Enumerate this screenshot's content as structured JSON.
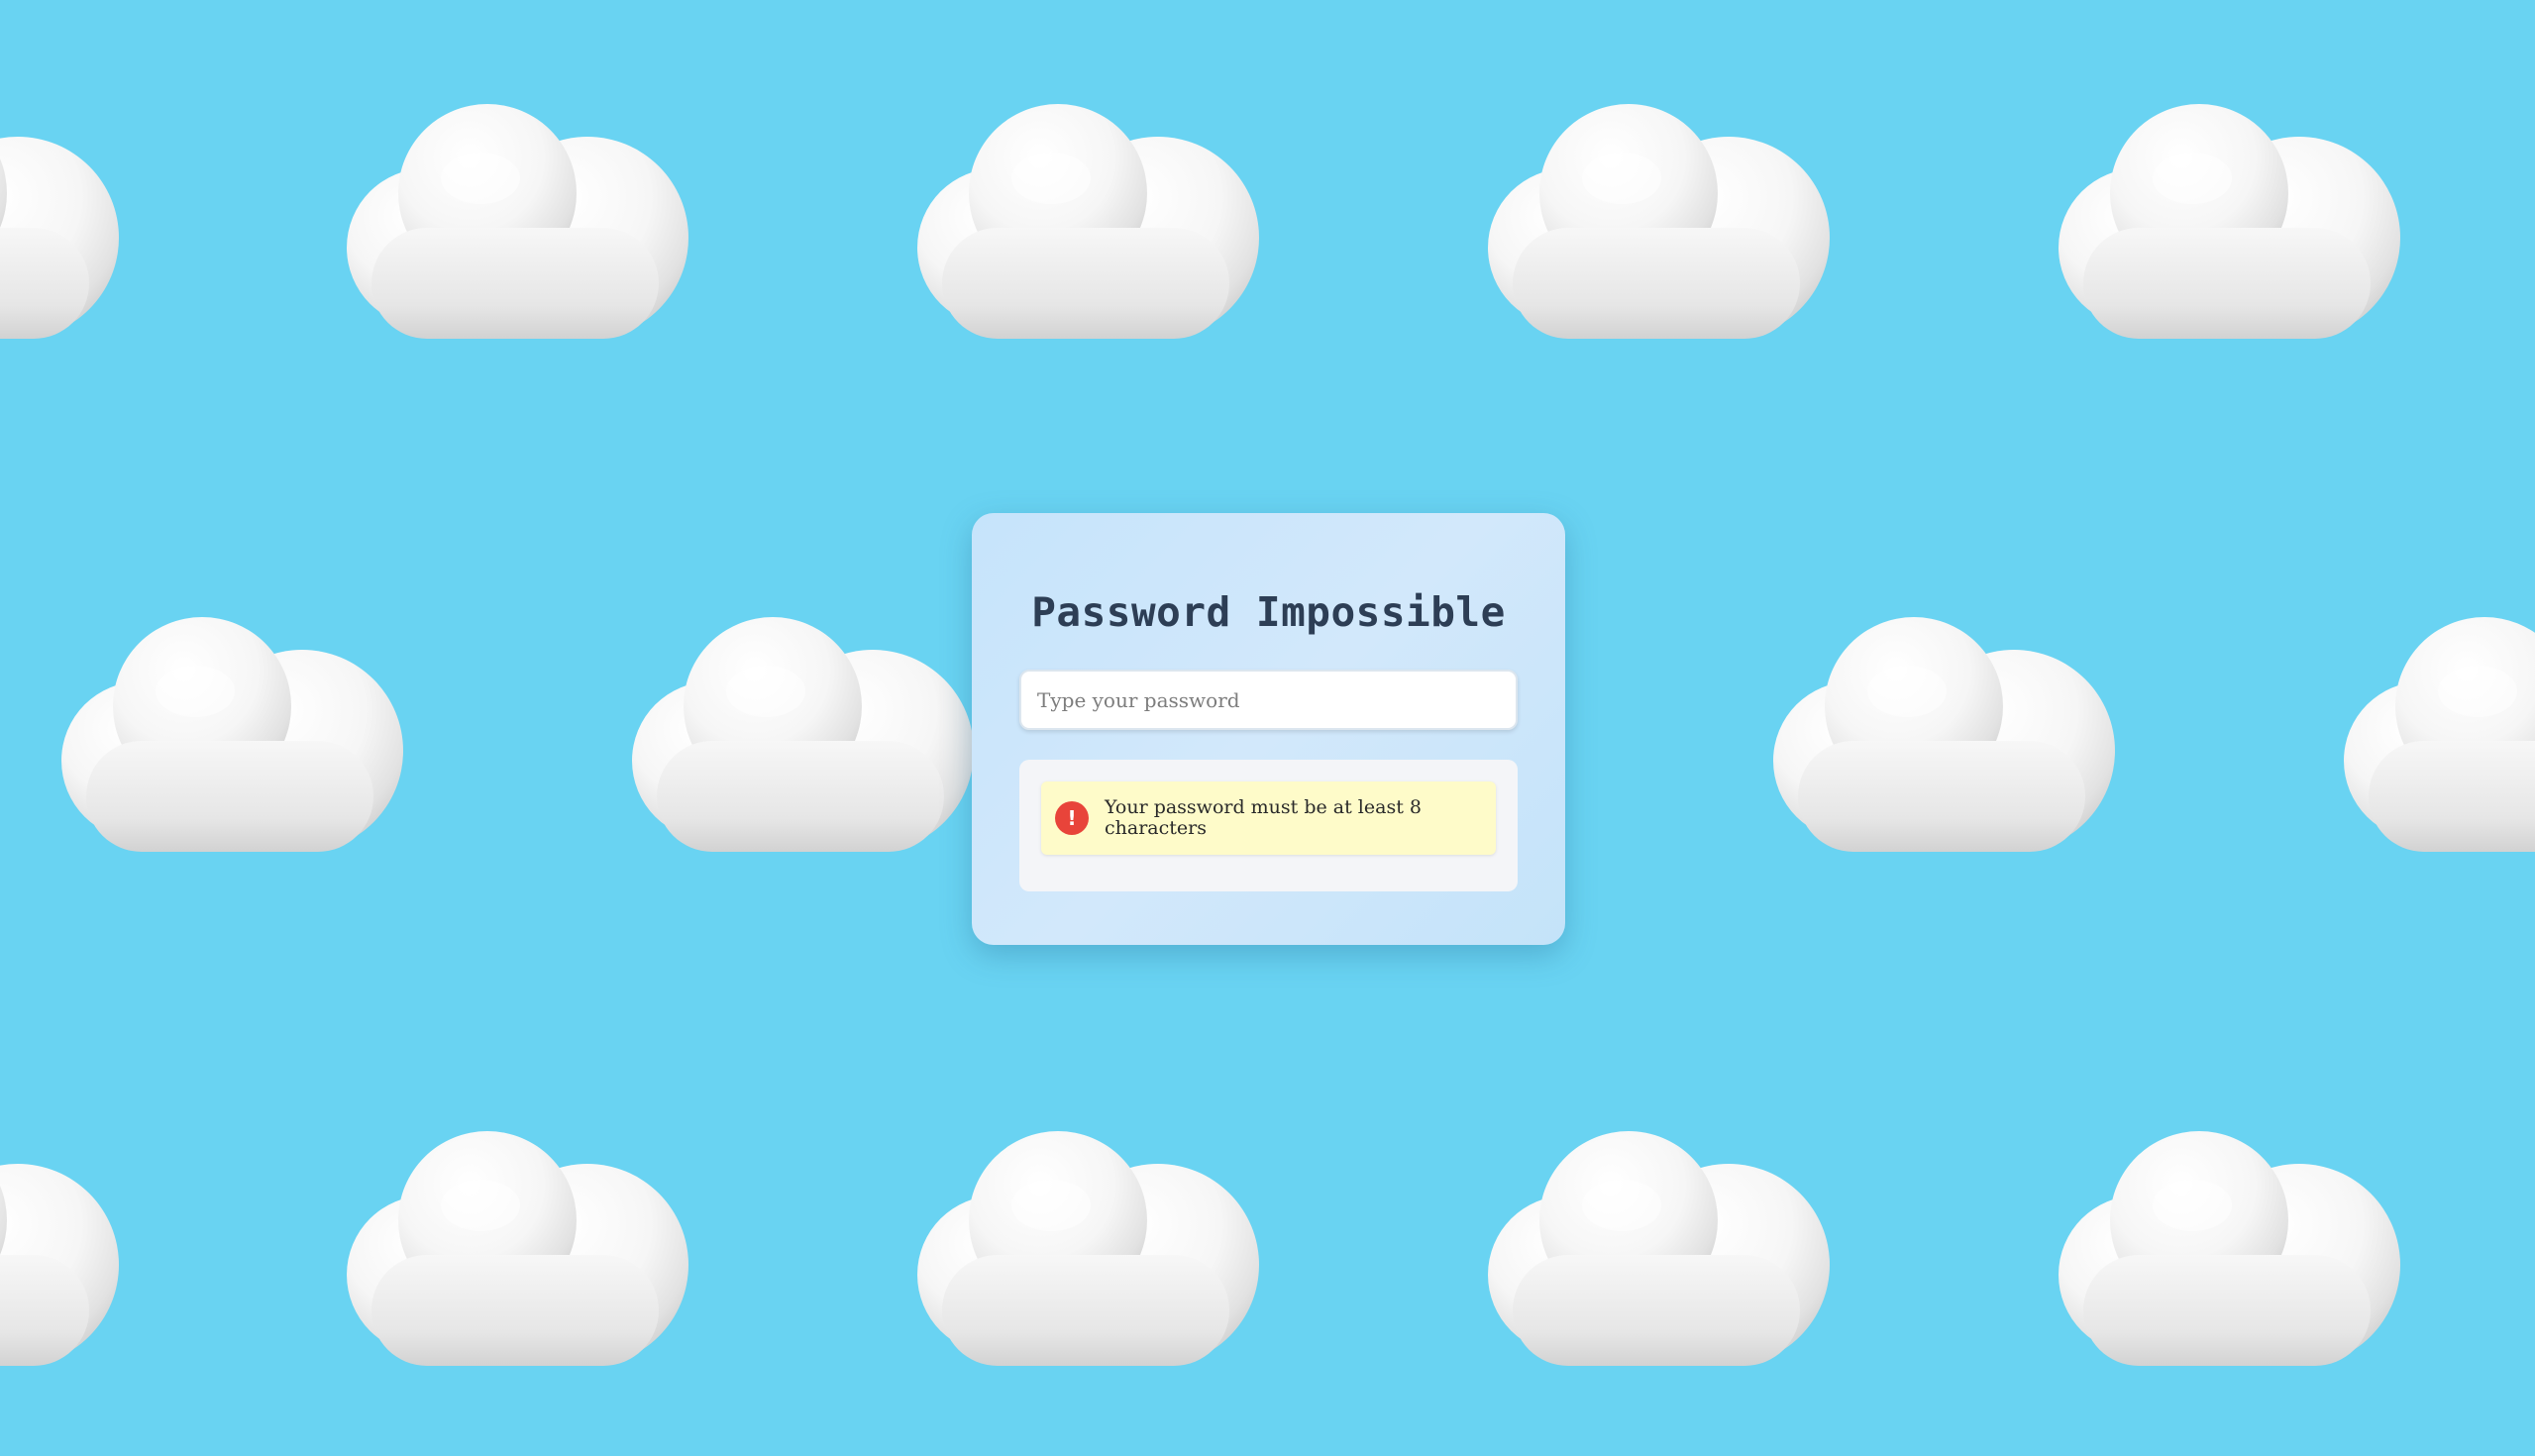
{
  "app": {
    "title": "Password Impossible"
  },
  "password": {
    "placeholder": "Type your password",
    "value": ""
  },
  "rules": [
    {
      "icon": "exclamation-icon",
      "text": "Your password must be at least 8 characters"
    }
  ],
  "colors": {
    "sky": "#69d3f2",
    "card": "#c6e4fb",
    "title": "#2d3e55",
    "rule_background": "#fefbc9",
    "rule_icon": "#e8443a"
  }
}
